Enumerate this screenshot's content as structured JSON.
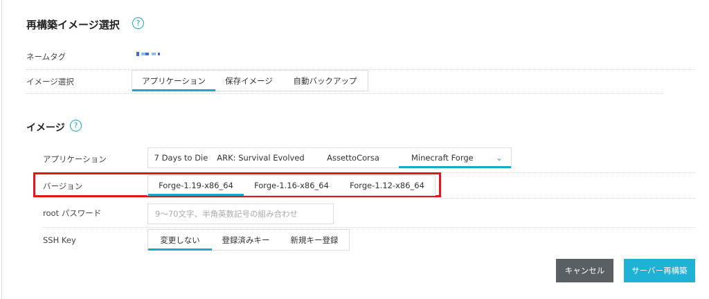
{
  "title": "再構築イメージ選択",
  "image_section_title": "イメージ",
  "name_tag": {
    "label": "ネームタグ"
  },
  "image_select": {
    "label": "イメージ選択",
    "tabs": [
      "アプリケーション",
      "保存イメージ",
      "自動バックアップ"
    ],
    "active": 0
  },
  "application": {
    "label": "アプリケーション",
    "tabs": [
      "7 Days to Die",
      "ARK: Survival Evolved",
      "AssettoCorsa",
      "Minecraft Forge"
    ],
    "active": 3
  },
  "version": {
    "label": "バージョン",
    "tabs": [
      "Forge-1.19-x86_64",
      "Forge-1.16-x86_64",
      "Forge-1.12-x86_64"
    ],
    "active": 0
  },
  "root_password": {
    "label": "root パスワード",
    "placeholder": "9〜70文字、半角英数記号の組み合わせ"
  },
  "ssh_key": {
    "label": "SSH Key",
    "tabs": [
      "変更しない",
      "登録済みキー",
      "新規キー登録"
    ],
    "active": 0
  },
  "buttons": {
    "cancel": "キャンセル",
    "rebuild": "サーバー再構築"
  },
  "colors": {
    "accent": "#1aa7c9",
    "cancel_bg": "#5a5f63",
    "highlight": "#e0161c"
  }
}
